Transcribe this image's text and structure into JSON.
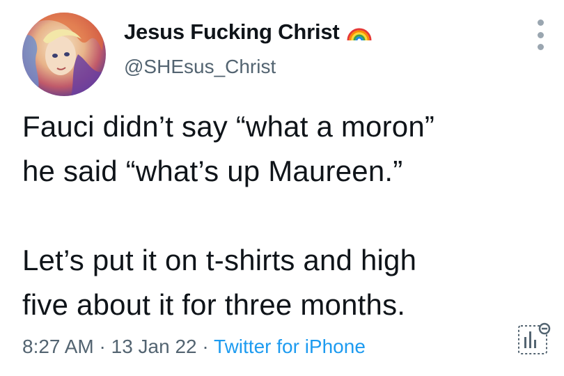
{
  "tweet": {
    "display_name": "Jesus Fucking Christ",
    "handle": "@SHEsus_Christ",
    "lines_p1": [
      "Fauci didn’t say “what a moron”",
      "he said “what’s up Maureen.”"
    ],
    "lines_p2": [
      "Let’s put it on t-shirts and high",
      "five about it for three months."
    ],
    "time": "8:27 AM",
    "separator": " · ",
    "date": "13 Jan 22",
    "source": "Twitter for iPhone"
  },
  "icons": {
    "verified_badge": "rainbow-icon",
    "more": "more-dots-icon",
    "analytics": "analytics-icon"
  },
  "colors": {
    "text": "#0f1419",
    "secondary": "#536471",
    "link": "#1d9bf0"
  }
}
